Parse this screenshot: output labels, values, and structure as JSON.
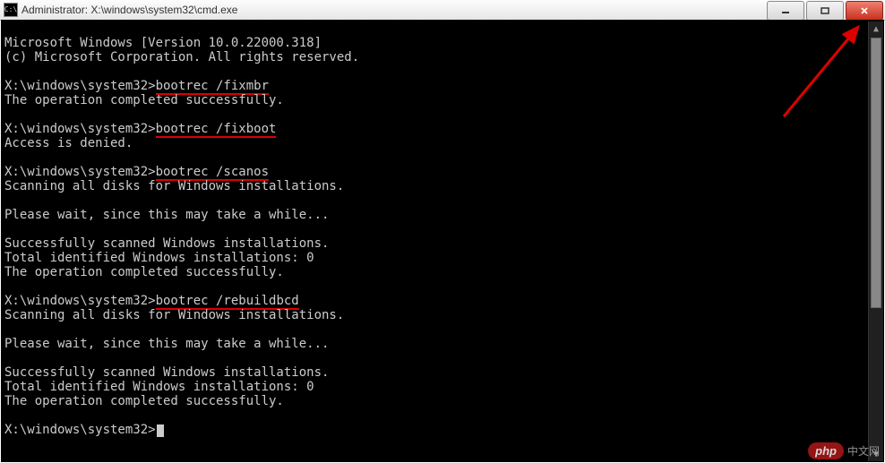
{
  "window": {
    "title": "Administrator: X:\\windows\\system32\\cmd.exe",
    "app_icon_label": "cmd-icon",
    "app_icon_glyph": "C:\\"
  },
  "terminal": {
    "header1": "Microsoft Windows [Version 10.0.22000.318]",
    "header2": "(c) Microsoft Corporation. All rights reserved.",
    "prompt": "X:\\windows\\system32>",
    "commands": [
      {
        "cmd": "bootrec /fixmbr",
        "output": [
          "The operation completed successfully."
        ]
      },
      {
        "cmd": "bootrec /fixboot",
        "output": [
          "Access is denied."
        ]
      },
      {
        "cmd": "bootrec /scanos",
        "output": [
          "Scanning all disks for Windows installations.",
          "",
          "Please wait, since this may take a while...",
          "",
          "Successfully scanned Windows installations.",
          "Total identified Windows installations: 0",
          "The operation completed successfully."
        ]
      },
      {
        "cmd": "bootrec /rebuildbcd",
        "output": [
          "Scanning all disks for Windows installations.",
          "",
          "Please wait, since this may take a while...",
          "",
          "Successfully scanned Windows installations.",
          "Total identified Windows installations: 0",
          "The operation completed successfully."
        ]
      }
    ]
  },
  "watermark": {
    "badge": "php",
    "text": "中文网"
  },
  "annotations": {
    "arrow_target": "close button"
  }
}
